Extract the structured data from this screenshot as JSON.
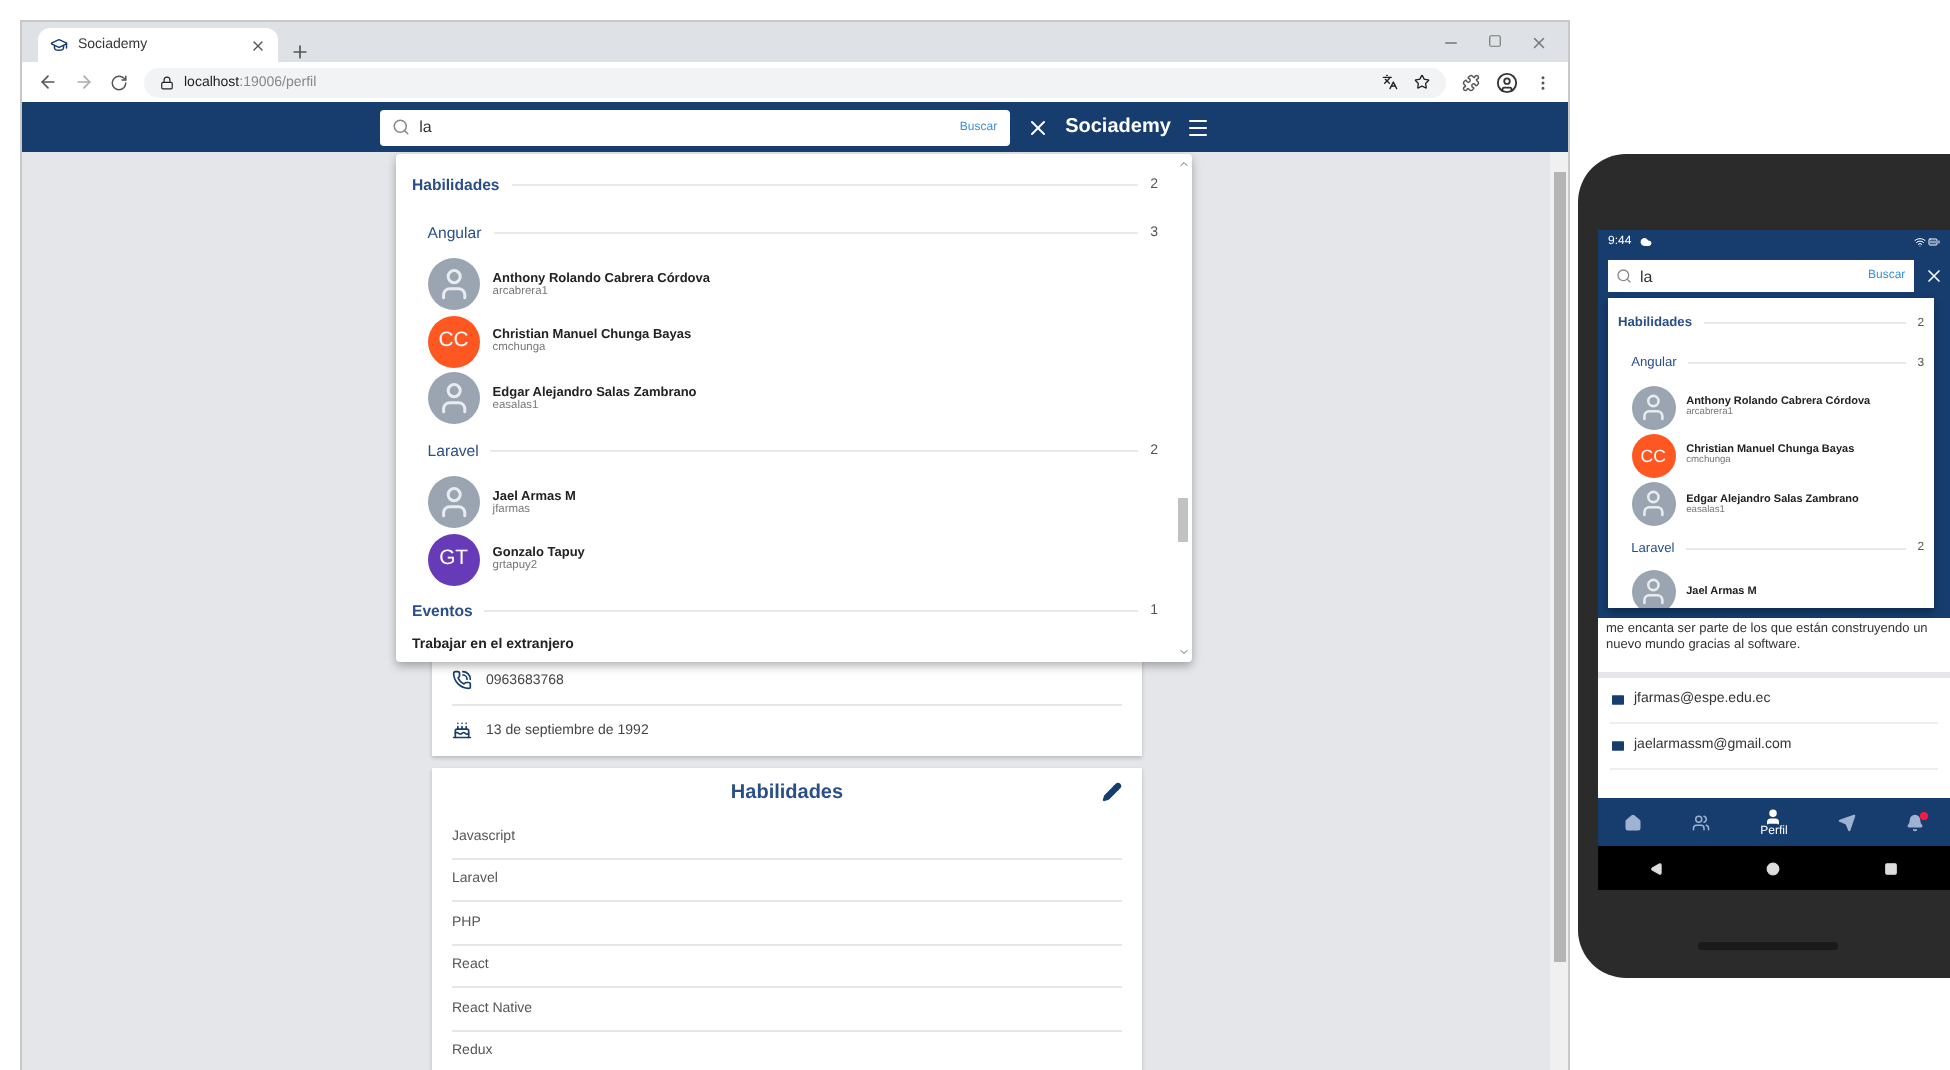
{
  "browser": {
    "tab_title": "Sociademy",
    "url_host": "localhost",
    "url_path": ":19006/perfil"
  },
  "app": {
    "search_value": "la",
    "search_button": "Buscar",
    "brand": "Sociademy"
  },
  "results": [
    {
      "title": "Habilidades",
      "count": "2",
      "groups": [
        {
          "title": "Angular",
          "count": "3",
          "users": [
            {
              "name": "Anthony Rolando Cabrera Córdova",
              "username": "arcabrera1",
              "kind": "photo"
            },
            {
              "name": "Christian Manuel Chunga Bayas",
              "username": "cmchunga",
              "kind": "initials",
              "initials": "CC",
              "color": "#ff5722"
            },
            {
              "name": "Edgar Alejandro Salas Zambrano",
              "username": "easalas1",
              "kind": "photo"
            }
          ]
        },
        {
          "title": "Laravel",
          "count": "2",
          "users": [
            {
              "name": "Jael Armas M",
              "username": "jfarmas",
              "kind": "photo"
            },
            {
              "name": "Gonzalo Tapuy",
              "username": "grtapuy2",
              "kind": "initials",
              "initials": "GT",
              "color": "#673ab7"
            }
          ]
        }
      ]
    },
    {
      "title": "Eventos",
      "count": "1",
      "items": [
        "Trabajar en el extranjero"
      ]
    }
  ],
  "contact_rows": [
    {
      "kind": "phone",
      "text": "0963683768"
    },
    {
      "kind": "birthday",
      "text": "13 de septiembre de 1992"
    }
  ],
  "skills_card": {
    "title": "Habilidades",
    "items": [
      "Javascript",
      "Laravel",
      "PHP",
      "React",
      "React Native",
      "Redux"
    ]
  },
  "phone": {
    "time": "9:44",
    "search_value": "la",
    "search_button": "Buscar",
    "results": [
      {
        "title": "Habilidades",
        "count": "2",
        "groups": [
          {
            "title": "Angular",
            "count": "3",
            "users": [
              {
                "name": "Anthony Rolando Cabrera Córdova",
                "username": "arcabrera1",
                "kind": "photo"
              },
              {
                "name": "Christian Manuel Chunga Bayas",
                "username": "cmchunga",
                "kind": "initials",
                "initials": "CC",
                "color": "#ff5722"
              },
              {
                "name": "Edgar Alejandro Salas Zambrano",
                "username": "easalas1",
                "kind": "photo"
              }
            ]
          },
          {
            "title": "Laravel",
            "count": "2",
            "users": [
              {
                "name": "Jael Armas M",
                "kind": "photo"
              }
            ]
          }
        ]
      }
    ],
    "bio": "me encanta ser parte de los que están construyendo un nuevo mundo gracias al software.",
    "contacts": [
      {
        "kind": "email",
        "text": "jfarmas@espe.edu.ec"
      },
      {
        "kind": "email",
        "text": "jaelarmassm@gmail.com"
      }
    ],
    "nav": [
      {
        "kind": "home",
        "selected": false,
        "alert": false
      },
      {
        "kind": "groups",
        "selected": false,
        "alert": false
      },
      {
        "kind": "profile",
        "label": "Perfil",
        "selected": true,
        "alert": false
      },
      {
        "kind": "send",
        "selected": false,
        "alert": false
      },
      {
        "kind": "bell",
        "selected": false,
        "alert": true
      }
    ]
  }
}
